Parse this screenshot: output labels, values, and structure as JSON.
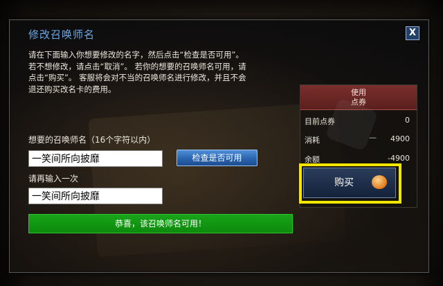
{
  "dialog": {
    "title": "修改召唤师名",
    "close_label": "X",
    "instructions": [
      "请在下面输入你想要修改的名字，然后点击“检查是否可用”。",
      "若不想修改，请点击“取消”。 若你的想要的召唤师名可用，请",
      "点击“购买”。 客服将会对不当的召唤师名进行修改，并且不会",
      "退还购买改名卡的费用。"
    ],
    "name_label": "想要的召唤师名（16个字符以内）",
    "name_value": "一笑间所向披靡",
    "confirm_label": "请再输入一次",
    "confirm_value": "一笑间所向披靡",
    "check_button": "检查是否可用",
    "success_message": "恭喜，该召唤师名可用！"
  },
  "panel": {
    "header_line1": "使用",
    "header_line2": "点券",
    "rows": [
      {
        "label": "目前点券",
        "value": "0"
      },
      {
        "label": "消耗",
        "dash": "—",
        "value": "4900"
      },
      {
        "label": "余额",
        "value": "-4900"
      }
    ],
    "buy_button": "购买",
    "buy_icon": "coin-icon"
  },
  "colors": {
    "title": "#6aa8e8",
    "success": "#0c8a0c",
    "highlight": "#f2e600",
    "panel_header": "#7a2f2c"
  }
}
